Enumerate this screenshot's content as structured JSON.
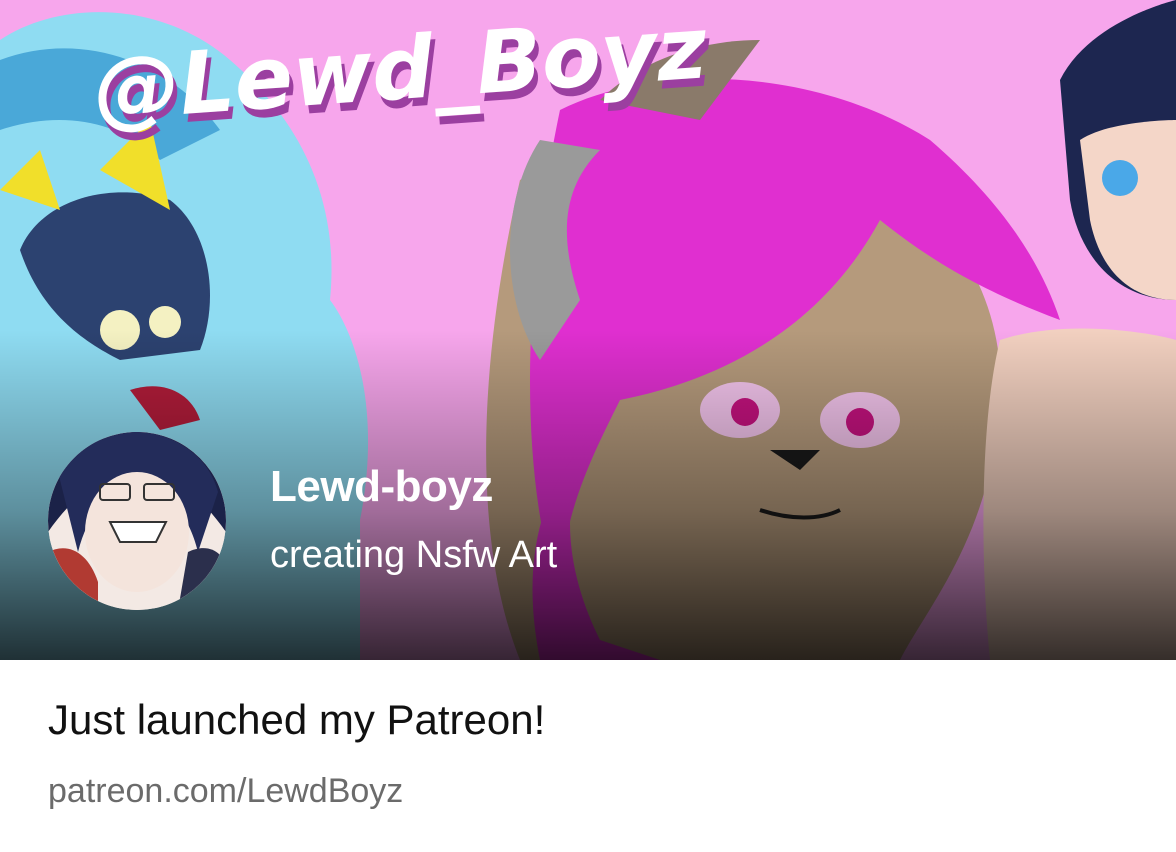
{
  "banner": {
    "watermark_text": "@Lewd_Boyz",
    "colors": {
      "background": "#f7a6ec",
      "accent_magenta": "#e02fd0",
      "shark_blue": "#8fdcf2"
    }
  },
  "creator": {
    "name": "Lewd-boyz",
    "tagline": "creating Nsfw Art",
    "avatar_icon": "creator-avatar"
  },
  "post": {
    "title": "Just launched my Patreon!",
    "link_text": "patreon.com/LewdBoyz"
  }
}
